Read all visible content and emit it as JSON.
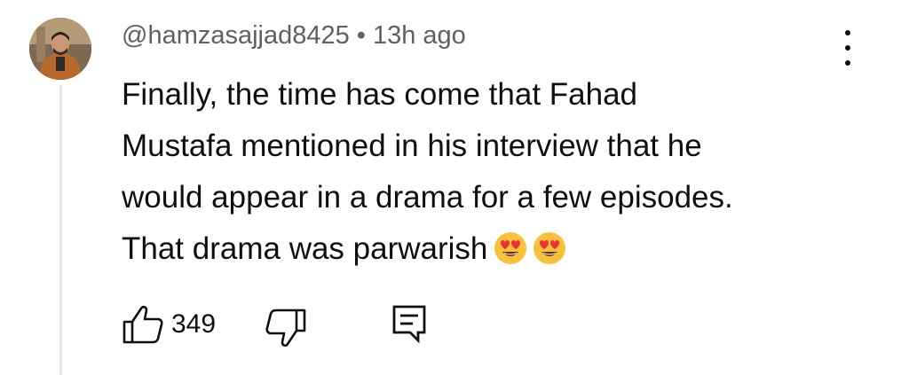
{
  "comment": {
    "author": "@hamzasajjad8425",
    "separator": "•",
    "time": "13h ago",
    "text_lines": [
      "Finally, the time has come that Fahad",
      "Mustafa mentioned in his interview that he",
      "would appear in a drama for a few episodes.",
      "That drama was parwarish"
    ],
    "emojis": [
      "heart-eyes-emoji",
      "heart-eyes-emoji"
    ],
    "like_count": "349"
  },
  "icons": {
    "like": "thumbs-up-icon",
    "dislike": "thumbs-down-icon",
    "reply": "reply-comment-icon",
    "menu": "more-vertical-icon"
  },
  "colors": {
    "text_primary": "#0f0f0f",
    "text_secondary": "#606060",
    "thread_line": "#e5e5e5",
    "emoji_face": "#f7c23a",
    "emoji_heart": "#e8323c"
  }
}
